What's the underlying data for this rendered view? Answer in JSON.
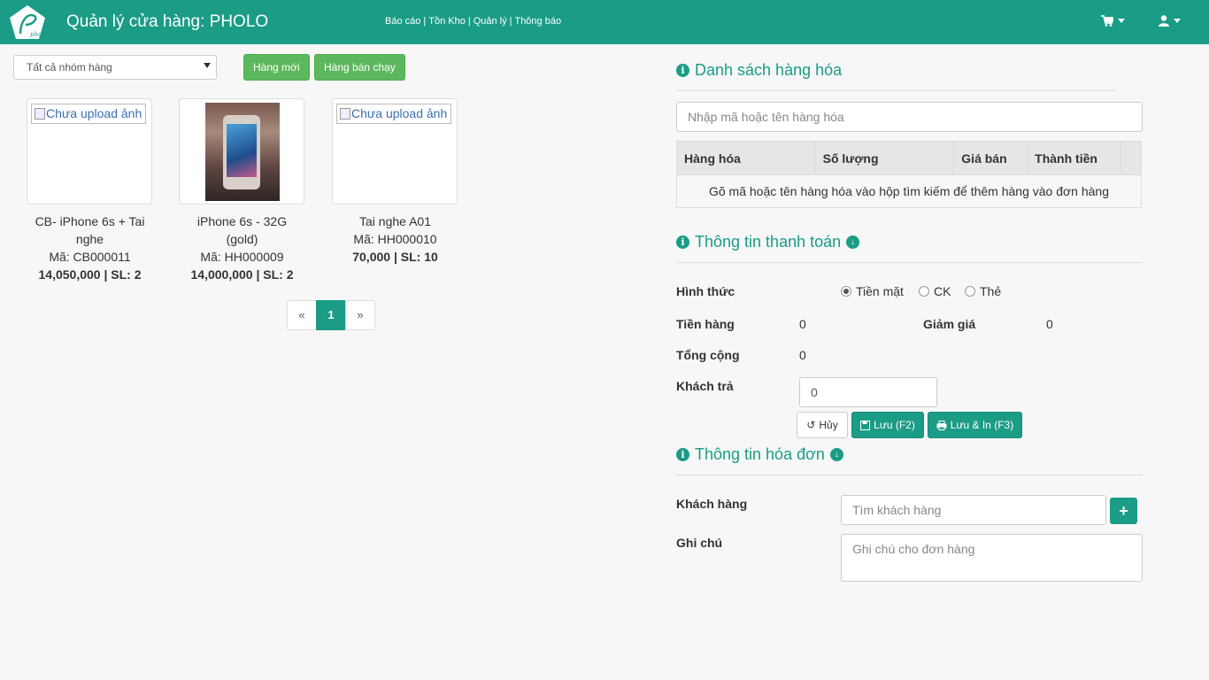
{
  "header": {
    "title": "Quản lý cửa hàng: PHOLO",
    "logo_text": "pholo",
    "nav": [
      "Báo cáo",
      "Tồn Kho",
      "Quản lý",
      "Thông báo"
    ],
    "cart_icon": "shopping-cart-icon",
    "user_icon": "user-icon"
  },
  "filters": {
    "group_select": "Tất cả nhóm hàng",
    "new_button": "Hàng mới",
    "bestseller_button": "Hàng bán chạy"
  },
  "products": [
    {
      "name": "CB- iPhone 6s + Tai nghe",
      "code": "Mã: CB000011",
      "price": "14,050,000 | SL: 2",
      "image_alt": "Chưa upload ảnh"
    },
    {
      "name": "iPhone 6s - 32G (gold)",
      "code": "Mã: HH000009",
      "price": "14,000,000 | SL: 2",
      "image_alt": ""
    },
    {
      "name": "Tai nghe A01",
      "code": "Mã: HH000010",
      "price": "70,000 | SL: 10",
      "image_alt": "Chưa upload ảnh"
    }
  ],
  "pagination": {
    "prev": "«",
    "current": "1",
    "next": "»"
  },
  "product_list": {
    "title": "Danh sách hàng hóa",
    "search_placeholder": "Nhập mã hoặc tên hàng hóa",
    "columns": [
      "Hàng hóa",
      "Số lượng",
      "Giá bán",
      "Thành tiền"
    ],
    "empty_message": "Gõ mã hoặc tên hàng hóa vào hộp tìm kiếm để thêm hàng vào đơn hàng"
  },
  "payment": {
    "title": "Thông tin thanh toán",
    "method_label": "Hình thức",
    "methods": [
      "Tiền mặt",
      "CK",
      "Thẻ"
    ],
    "selected_method": "Tiền mặt",
    "subtotal_label": "Tiền hàng",
    "subtotal_value": "0",
    "discount_label": "Giảm giá",
    "discount_value": "0",
    "total_label": "Tổng cộng",
    "total_value": "0",
    "paid_label": "Khách trả",
    "paid_value": "0",
    "cancel_button": "Hủy",
    "save_button": "Lưu (F2)",
    "save_print_button": "Lưu & In (F3)"
  },
  "invoice": {
    "title": "Thông tin hóa đơn",
    "customer_label": "Khách hàng",
    "customer_placeholder": "Tìm khách hàng",
    "note_label": "Ghi chú",
    "note_placeholder": "Ghi chú cho đơn hàng"
  },
  "colors": {
    "primary": "#1a9c86",
    "success": "#5cb85c"
  }
}
